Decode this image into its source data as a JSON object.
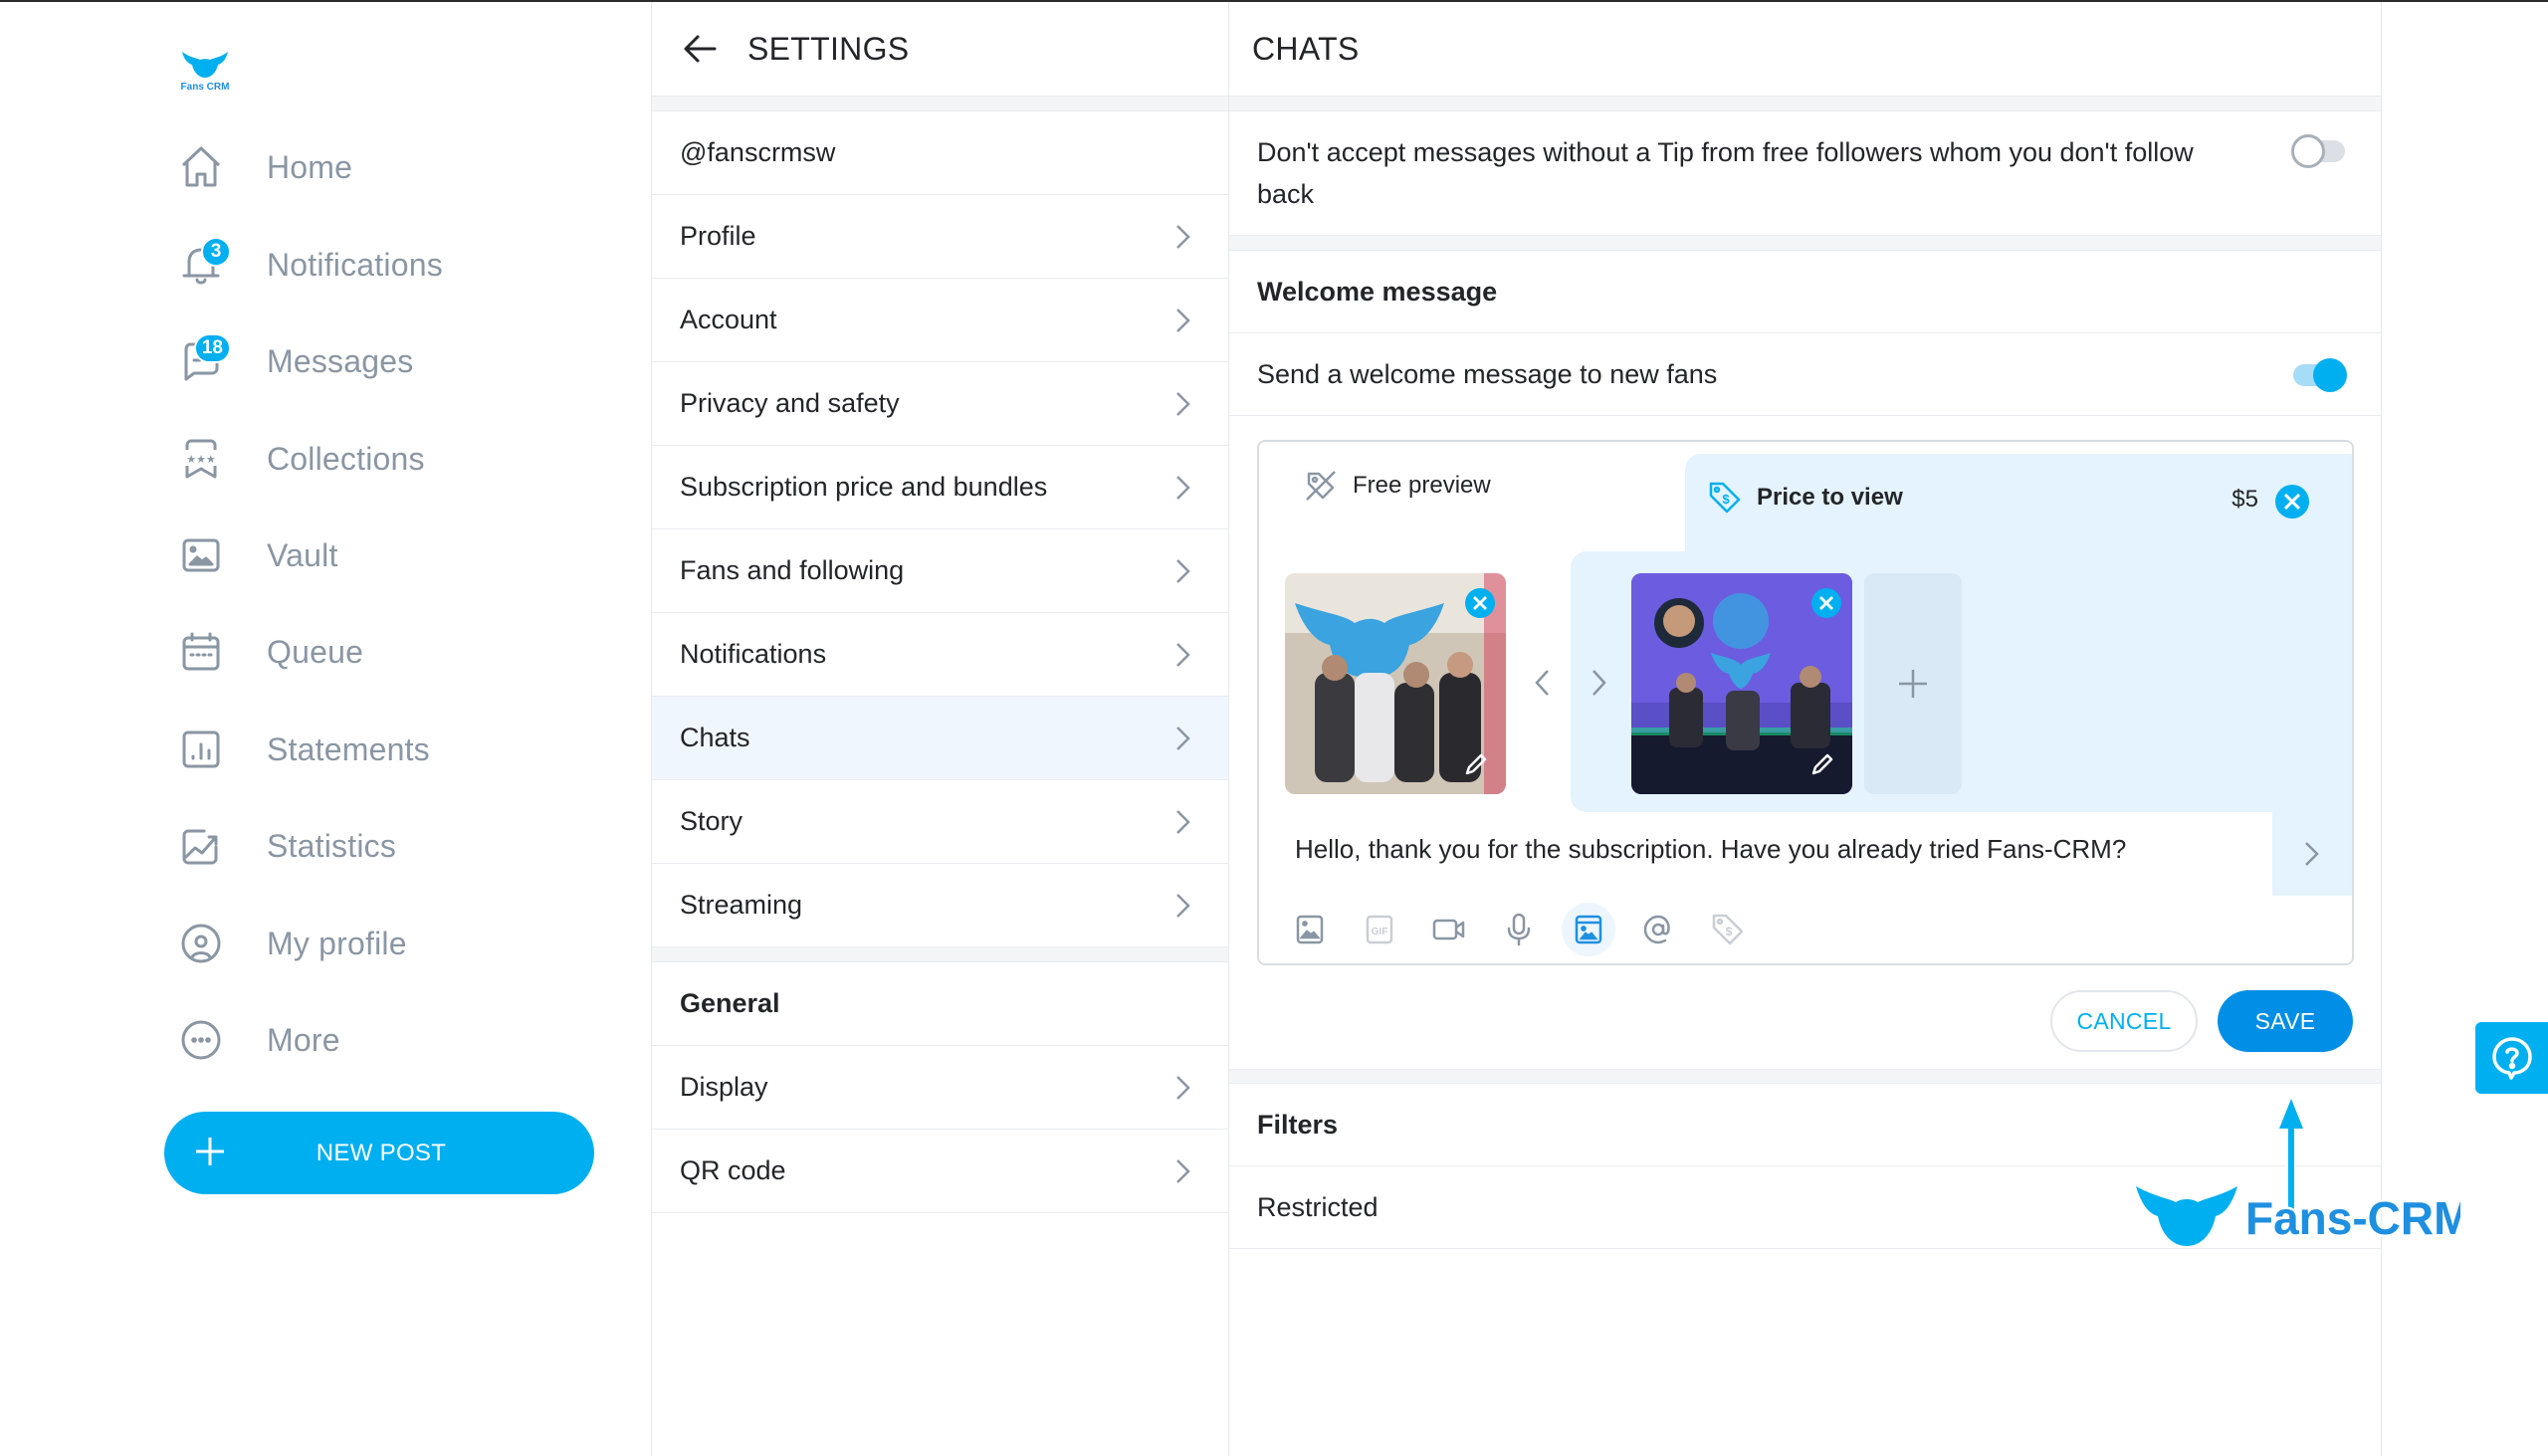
{
  "brand": {
    "logo_text": "Fans CRM",
    "accent": "#00aff0",
    "save_blue": "#008ee6",
    "watermark_text": "Fans-CRM"
  },
  "sidebar": {
    "items": [
      {
        "label": "Home",
        "icon": "home-icon"
      },
      {
        "label": "Notifications",
        "icon": "bell-icon",
        "badge": "3"
      },
      {
        "label": "Messages",
        "icon": "message-icon",
        "badge": "18"
      },
      {
        "label": "Collections",
        "icon": "bookmark-stars-icon"
      },
      {
        "label": "Vault",
        "icon": "image-icon"
      },
      {
        "label": "Queue",
        "icon": "calendar-icon"
      },
      {
        "label": "Statements",
        "icon": "bar-chart-icon"
      },
      {
        "label": "Statistics",
        "icon": "trend-chart-icon"
      },
      {
        "label": "My profile",
        "icon": "user-circle-icon"
      },
      {
        "label": "More",
        "icon": "more-circle-icon"
      }
    ],
    "new_post_label": "NEW POST"
  },
  "settings": {
    "title": "SETTINGS",
    "username": "@fanscrmsw",
    "items": [
      {
        "label": "Profile"
      },
      {
        "label": "Account"
      },
      {
        "label": "Privacy and safety"
      },
      {
        "label": "Subscription price and bundles"
      },
      {
        "label": "Fans and following"
      },
      {
        "label": "Notifications"
      },
      {
        "label": "Chats",
        "active": true
      },
      {
        "label": "Story"
      },
      {
        "label": "Streaming"
      }
    ],
    "general_title": "General",
    "general_items": [
      {
        "label": "Display"
      },
      {
        "label": "QR code"
      }
    ]
  },
  "chats": {
    "title": "CHATS",
    "tip_setting": {
      "label": "Don't accept messages without a Tip from free followers whom you don't follow back",
      "enabled": false
    },
    "welcome_title": "Welcome message",
    "welcome_setting": {
      "label": "Send a welcome message to new fans",
      "enabled": true
    },
    "composer": {
      "free_preview_label": "Free preview",
      "price_to_view_label": "Price to view",
      "price": "$5",
      "media_count": 2,
      "message": "Hello, thank you for the subscription. Have you already tried Fans-CRM?",
      "tools": [
        "image-icon",
        "gif-icon",
        "video-icon",
        "microphone-icon",
        "vault-icon",
        "mention-icon",
        "price-tag-icon"
      ],
      "active_tool": "vault-icon"
    },
    "cancel_label": "CANCEL",
    "save_label": "SAVE",
    "filters_title": "Filters",
    "restricted_label": "Restricted"
  }
}
